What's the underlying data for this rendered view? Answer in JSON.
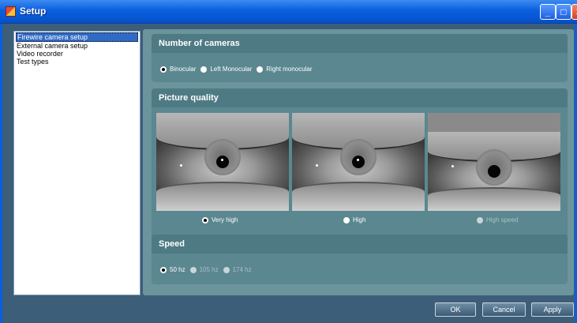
{
  "window": {
    "title": "Setup",
    "minimize_icon": "minimize-icon",
    "maximize_icon": "maximize-icon",
    "close_icon": "close-icon"
  },
  "sidebar": {
    "items": [
      {
        "label": "Firewire camera setup",
        "selected": true
      },
      {
        "label": "External camera setup",
        "selected": false
      },
      {
        "label": "Video recorder",
        "selected": false
      },
      {
        "label": "Test types",
        "selected": false
      }
    ]
  },
  "cameras": {
    "title": "Number of cameras",
    "options": [
      {
        "label": "Binocular",
        "checked": true
      },
      {
        "label": "Left Monocular",
        "checked": false
      },
      {
        "label": "Right monocular",
        "checked": false
      }
    ]
  },
  "quality": {
    "title": "Picture quality",
    "options": [
      {
        "label": "Very high",
        "checked": true,
        "enabled": true
      },
      {
        "label": "High",
        "checked": false,
        "enabled": true
      },
      {
        "label": "High speed",
        "checked": false,
        "enabled": false
      }
    ]
  },
  "speed": {
    "title": "Speed",
    "options": [
      {
        "label": "50 hz",
        "checked": true,
        "enabled": true
      },
      {
        "label": "105 hz",
        "checked": false,
        "enabled": false
      },
      {
        "label": "174 hz",
        "checked": false,
        "enabled": false
      }
    ]
  },
  "buttons": {
    "ok": "OK",
    "cancel": "Cancel",
    "apply": "Apply"
  }
}
